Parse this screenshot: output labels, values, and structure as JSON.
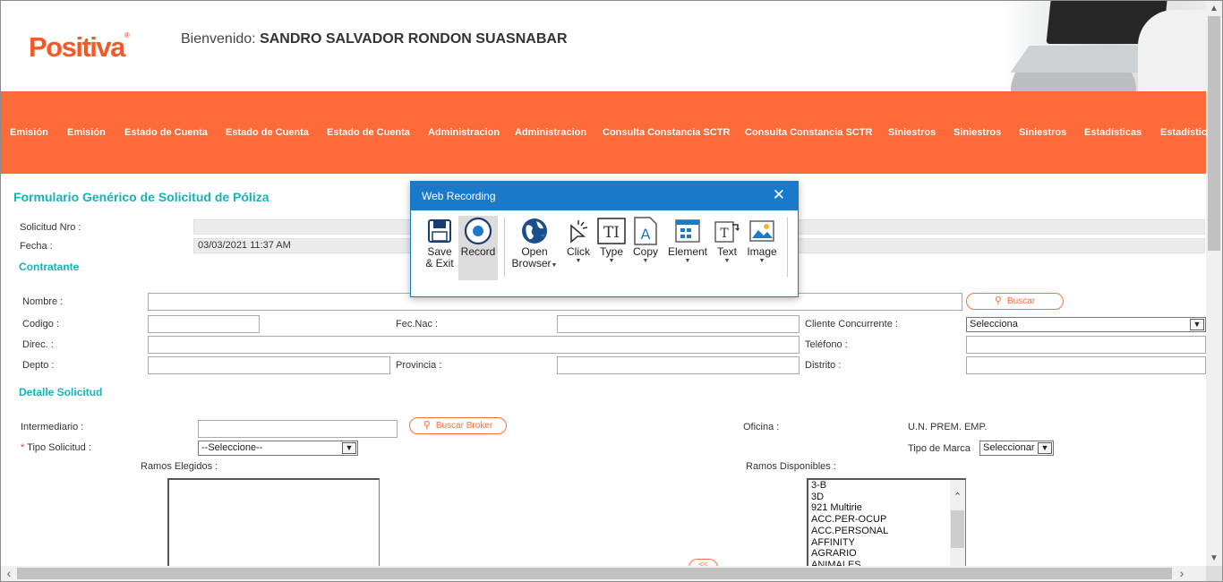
{
  "header": {
    "logo_text": "Positiva",
    "logo_mark": "®",
    "welcome_label": "Bienvenido:",
    "user_name": "SANDRO SALVADOR RONDON SUASNABAR"
  },
  "nav": {
    "items": [
      "Emisión",
      "Emisión",
      "Estado de Cuenta",
      "Estado de Cuenta",
      "Estado de Cuenta",
      "Administracion",
      "Administracion",
      "Consulta Constancia SCTR",
      "Consulta Constancia SCTR",
      "Siniestros",
      "Siniestros",
      "Siniestros",
      "Estadísticas",
      "Estadísticas"
    ]
  },
  "form": {
    "title": "Formulario Genérico de Solicitud de Póliza",
    "solicitud_label": "Solicitud Nro :",
    "solicitud_value": "",
    "fecha_label": "Fecha :",
    "fecha_value": "03/03/2021 11:37 AM",
    "contratante": {
      "title": "Contratante",
      "nombre_label": "Nombre :",
      "buscar_label": "Buscar",
      "codigo_label": "Codigo :",
      "fecnac_label": "Fec.Nac :",
      "cliente_label": "Cliente Concurrente :",
      "cliente_value": "Selecciona",
      "direc_label": "Direc. :",
      "telefono_label": "Teléfono :",
      "depto_label": "Depto :",
      "provincia_label": "Provincia :",
      "distrito_label": "Distrito :"
    },
    "detalle": {
      "title": "Detalle Solicitud",
      "intermediario_label": "Intermediario :",
      "buscar_broker_label": "Buscar Broker",
      "oficina_label": "Oficina :",
      "oficina_value": "U.N. PREM. EMP.",
      "tipo_solicitud_req": "*",
      "tipo_solicitud_label": "Tipo Solicitud :",
      "tipo_solicitud_value": "--Seleccione--",
      "tipo_marca_label": "Tipo de Marca",
      "tipo_marca_value": "Seleccionar",
      "ramos_elegidos_label": "Ramos Elegidos :",
      "ramos_disponibles_label": "Ramos Disponibles :",
      "ramos_disponibles": [
        "3-B",
        "3D",
        "921 Multirie",
        "ACC.PER-OCUP",
        "ACC.PERSONAL",
        "AFFINITY",
        "AGRARIO",
        "ANIMALES"
      ],
      "move_button_label": "<<"
    }
  },
  "dialog": {
    "title": "Web Recording",
    "close_glyph": "✕",
    "tools": {
      "save_l1": "Save",
      "save_l2": "& Exit",
      "record": "Record",
      "open_l1": "Open",
      "open_l2": "Browser",
      "click": "Click",
      "type": "Type",
      "copy": "Copy",
      "element": "Element",
      "text": "Text",
      "image": "Image"
    }
  },
  "colors": {
    "brand_orange": "#fe6b39",
    "teal_heading": "#16b2b8",
    "dialog_blue": "#1979ca"
  }
}
